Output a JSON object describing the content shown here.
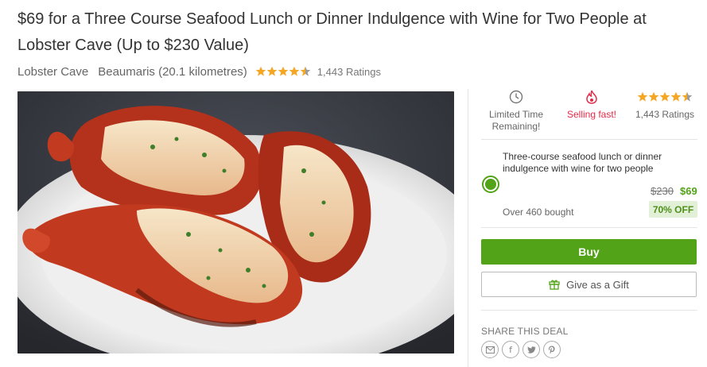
{
  "deal": {
    "title": "$69 for a Three Course Seafood Lunch or Dinner Indulgence with Wine for Two People at Lobster Cave (Up to $230 Value)",
    "merchant": "Lobster Cave",
    "location": "Beaumaris (20.1 kilometres)",
    "rating_stars": 4.5,
    "ratings_text": "1,443 Ratings"
  },
  "badges": {
    "limited_line1": "Limited Time",
    "limited_line2": "Remaining!",
    "selling_fast": "Selling fast!",
    "ratings": "1,443 Ratings"
  },
  "option": {
    "title": "Three-course seafood lunch or dinner indulgence with wine for two people",
    "original_price": "$230",
    "price": "$69",
    "bought": "Over 460 bought",
    "discount": "70% OFF",
    "selected": true
  },
  "actions": {
    "buy_label": "Buy",
    "gift_label": "Give as a Gift"
  },
  "share": {
    "label": "SHARE THIS DEAL",
    "icons": [
      "email-icon",
      "facebook-icon",
      "twitter-icon",
      "pinterest-icon"
    ]
  },
  "colors": {
    "accent_green": "#53a318",
    "star": "#f5a623",
    "selling_fast_red": "#e12a47"
  },
  "icons": {
    "clock": "clock-icon",
    "flame": "flame-icon",
    "gift": "gift-icon"
  }
}
